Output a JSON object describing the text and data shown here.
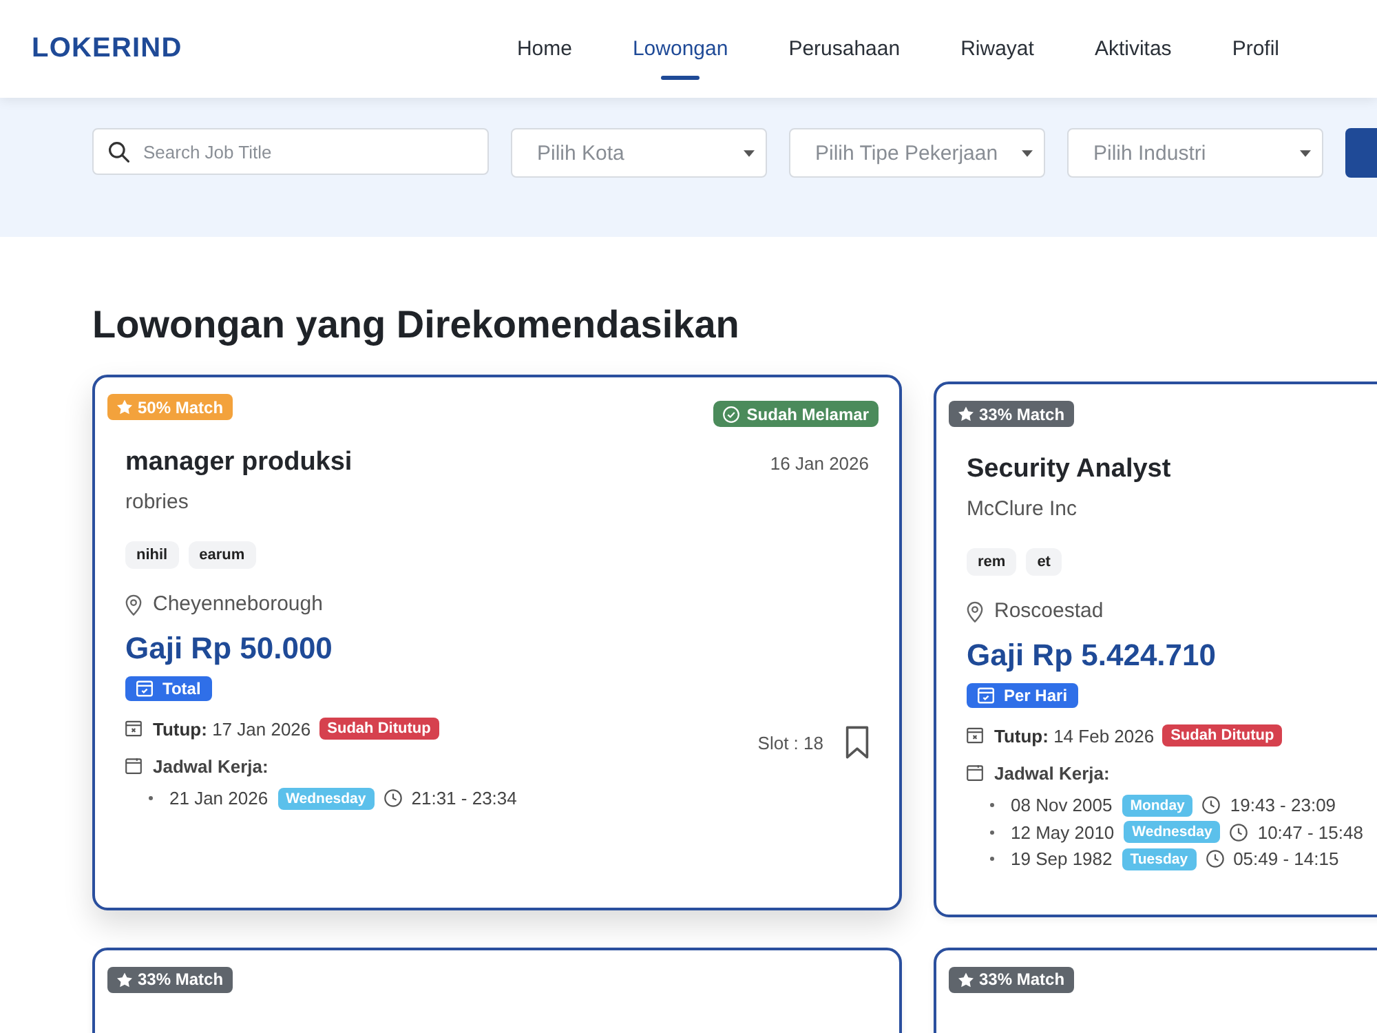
{
  "header": {
    "logo": "LOKERIND",
    "nav": [
      {
        "label": "Home",
        "selected": false
      },
      {
        "label": "Lowongan",
        "selected": true
      },
      {
        "label": "Perusahaan",
        "selected": false
      },
      {
        "label": "Riwayat",
        "selected": false
      },
      {
        "label": "Aktivitas",
        "selected": false
      },
      {
        "label": "Profil",
        "selected": false
      }
    ]
  },
  "filters": {
    "search": {
      "placeholder": "Search Job Title"
    },
    "selects": [
      {
        "placeholder": "Pilih Kota"
      },
      {
        "placeholder": "Pilih Tipe Pekerjaan"
      },
      {
        "placeholder": "Pilih Industri"
      }
    ]
  },
  "section_title": "Lowongan yang Direkomendasikan",
  "jobs": [
    {
      "raised": true,
      "match": {
        "label": "50% Match",
        "color": "#f3a23c"
      },
      "applied_label": "Sudah Melamar",
      "title": "manager produksi",
      "date": "16 Jan 2026",
      "company": "robries",
      "tags": [
        "nihil",
        "earum"
      ],
      "location": "Cheyenneborough",
      "salary": "Gaji Rp 50.000",
      "pay_type": "Total",
      "closing": "**Tutup:** 17 Jan 2026",
      "closed_status": "Sudah Ditutup",
      "schedule_label": "Jadwal Kerja:",
      "schedule": [
        {
          "date": "21 Jan 2026",
          "day": "Wednesday",
          "time": "21:31 - 23:34"
        }
      ],
      "slot": "Slot : 18"
    },
    {
      "raised": false,
      "match": {
        "label": "33% Match",
        "color": "#5f656c"
      },
      "title": "Security Analyst",
      "company": "McClure Inc",
      "tags": [
        "rem",
        "et"
      ],
      "location": "Roscoestad",
      "salary": "Gaji Rp 5.424.710",
      "pay_type": "Per Hari",
      "closing": "**Tutup:** 14 Feb 2026",
      "closed_status": "Sudah Ditutup",
      "schedule_label": "Jadwal Kerja:",
      "schedule": [
        {
          "date": "08 Nov 2005",
          "day": "Monday",
          "time": "19:43 - 23:09"
        },
        {
          "date": "12 May 2010",
          "day": "Wednesday",
          "time": "10:47 - 15:48"
        },
        {
          "date": "19 Sep 1982",
          "day": "Tuesday",
          "time": "05:49 - 14:15"
        }
      ]
    },
    {
      "raised": false,
      "match": {
        "label": "33% Match",
        "color": "#5f656c"
      }
    },
    {
      "raised": false,
      "match": {
        "label": "33% Match",
        "color": "#5f656c"
      }
    }
  ]
}
